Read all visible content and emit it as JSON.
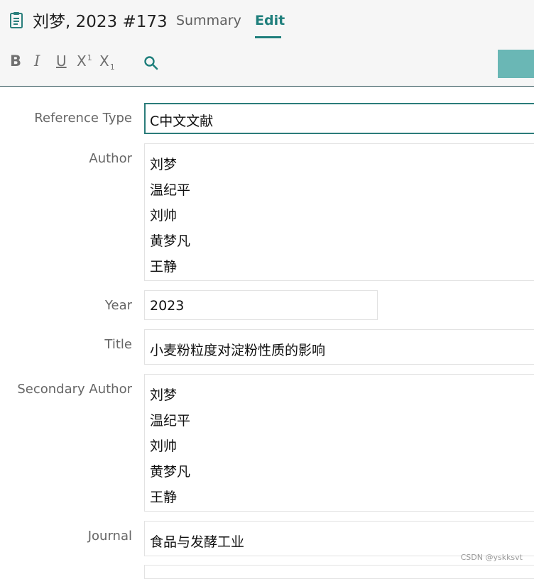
{
  "header": {
    "title": "刘梦, 2023 #173",
    "tabs": [
      {
        "label": "Summary",
        "active": false
      },
      {
        "label": "Edit",
        "active": true
      }
    ],
    "accent_color": "#1f7f7c"
  },
  "toolbar": {
    "bold": "B",
    "italic": "I",
    "underline": "U",
    "superscript": "X",
    "superscript_mark": "1",
    "subscript": "X",
    "subscript_mark": "1",
    "search_icon": "search-icon",
    "save_color": "#6ab7b5"
  },
  "form": {
    "reference_type": {
      "label": "Reference Type",
      "value": "C中文文献"
    },
    "author": {
      "label": "Author",
      "values": [
        "刘梦",
        "温纪平",
        "刘帅",
        "黄梦凡",
        "王静"
      ]
    },
    "year": {
      "label": "Year",
      "value": "2023"
    },
    "title": {
      "label": "Title",
      "value": "小麦粉粒度对淀粉性质的影响"
    },
    "secondary_author": {
      "label": "Secondary Author",
      "values": [
        "刘梦",
        "温纪平",
        "刘帅",
        "黄梦凡",
        "王静"
      ]
    },
    "journal": {
      "label": "Journal",
      "value": "食品与发酵工业"
    }
  },
  "watermark": "CSDN @yskksvt"
}
